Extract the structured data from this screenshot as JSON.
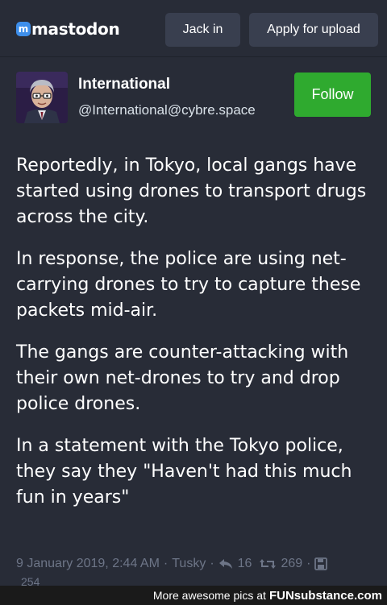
{
  "header": {
    "logo_text": "mastodon",
    "logo_mark": "m",
    "jack_in_label": "Jack in",
    "apply_label": "Apply for upload"
  },
  "profile": {
    "display_name": "International",
    "handle": "@International@cybre.space",
    "follow_label": "Follow"
  },
  "post": {
    "paragraphs": [
      "Reportedly, in Tokyo, local gangs have started using drones to transport drugs across the city.",
      "In response, the police are using net-carrying drones to try to capture these packets mid-air.",
      "The gangs are counter-attacking with their own net-drones to try and drop police drones.",
      "In a statement with the Tokyo police, they say they \"Haven't had this much fun in years\""
    ],
    "timestamp": "9 January 2019, 2:44 AM",
    "client": "Tusky",
    "reply_count": "16",
    "boost_count": "269",
    "partial_count": "254"
  },
  "footer": {
    "text": "More awesome pics at",
    "brand": "FUNsubstance.com"
  },
  "colors": {
    "background": "#282c37",
    "button": "#393f4f",
    "follow": "#2faa2f",
    "meta": "#6d7587",
    "logo_accent": "#3d8eea"
  },
  "icons": [
    "reply-icon",
    "boost-icon",
    "save-icon"
  ]
}
